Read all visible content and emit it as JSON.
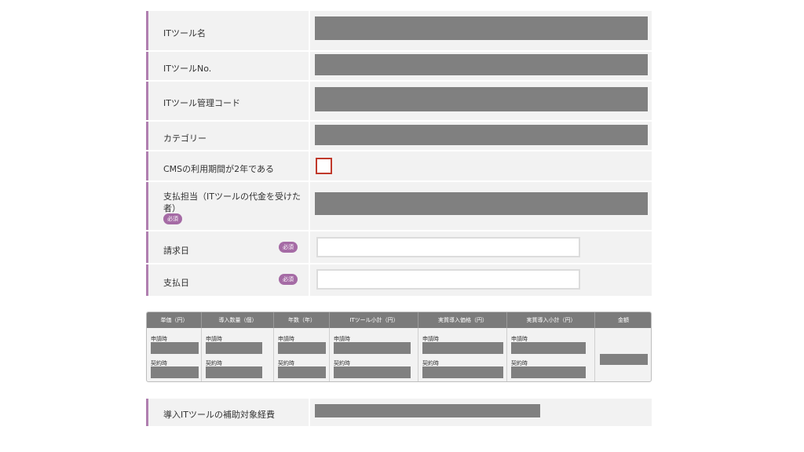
{
  "form": {
    "tool_name": {
      "label": "ITツール名"
    },
    "tool_no": {
      "label": "ITツールNo."
    },
    "tool_code": {
      "label": "ITツール管理コード"
    },
    "category": {
      "label": "カテゴリー"
    },
    "cms_period": {
      "label": "CMSの利用期間が2年である",
      "checked": false
    },
    "payee": {
      "label": "支払担当（ITツールの代金を受けた者）",
      "badge": "必須"
    },
    "invoice_date": {
      "label": "請求日",
      "badge": "必須",
      "value": ""
    },
    "payment_date": {
      "label": "支払日",
      "badge": "必須",
      "value": ""
    }
  },
  "price_table": {
    "sub_labels": {
      "application": "申請時",
      "contract": "契約時"
    },
    "columns": [
      {
        "header": "単価（円）"
      },
      {
        "header": "導入数量（個）"
      },
      {
        "header": "年数（年）"
      },
      {
        "header": "ITツール小計（円）"
      },
      {
        "header": "実質導入価格（円）"
      },
      {
        "header": "実質導入小計（円）"
      },
      {
        "header": "金額"
      }
    ]
  },
  "subsidy": {
    "label": "導入ITツールの補助対象経費"
  },
  "colors": {
    "accent": "#b07fb0",
    "badge": "#a56ba5",
    "masked": "#808080",
    "header": "#7b7b7b",
    "checkbox_border": "#c0392b"
  }
}
